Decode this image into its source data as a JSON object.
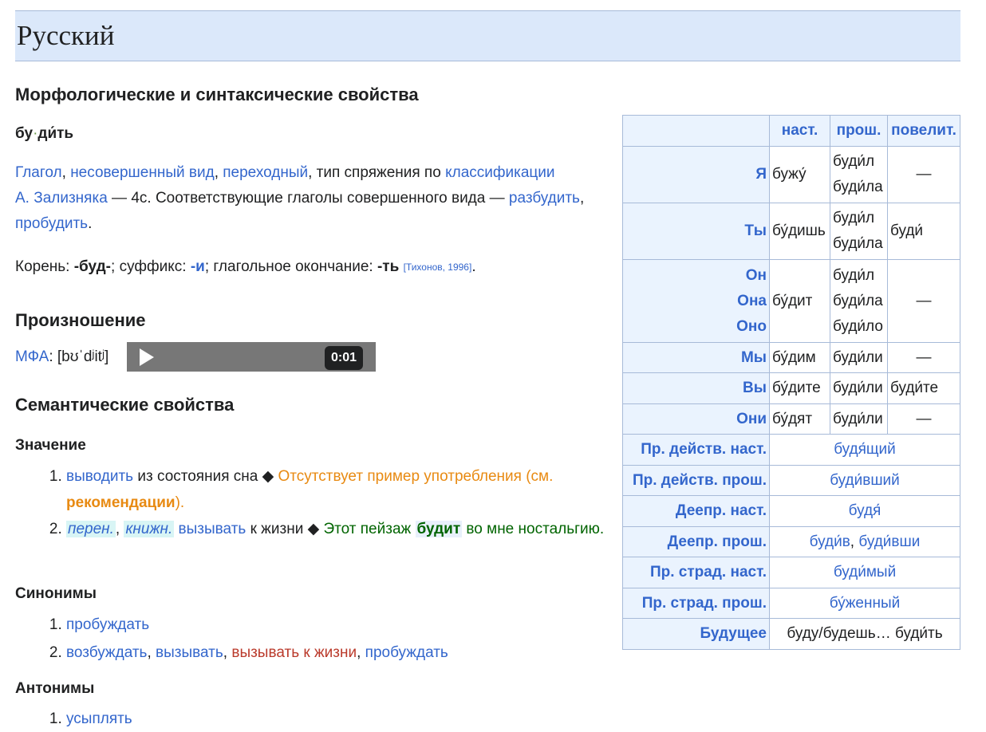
{
  "lang_header": "Русский",
  "morph": {
    "heading": "Морфологические и синтаксические свойства",
    "headword_part1": "бу",
    "headword_sep": "·",
    "headword_part2": "ди́ть",
    "desc": {
      "verb": "Глагол",
      "aspect": "несовершенный вид",
      "transitive": "переходный",
      "text1": ", тип спряжения по ",
      "classification_link": "классификации",
      "zaliznyak_link": "А. Зализняка",
      "text2": " — 4c. Соответствующие глаголы совершенного вида — ",
      "perf1": "разбудить",
      "perf2": "пробудить",
      "period": "."
    },
    "root_label": "Корень: ",
    "root": "-буд-",
    "suffix_label": "; суффикс: ",
    "suffix": "-и",
    "ending_label": "; глагольное окончание: ",
    "ending": "-ть",
    "ref": "[Тихонов, 1996]",
    "end": "."
  },
  "pron": {
    "heading": "Произношение",
    "ipa_label": "МФА",
    "ipa": ": [bʊˈdʲitʲ]",
    "audio_time": "0:01"
  },
  "semantic": {
    "heading": "Семантические свойства",
    "meaning_heading": "Значение",
    "m1_link": "выводить",
    "m1_text": " из состояния сна ◆ ",
    "m1_missing": "Отсутствует пример употребления (см. ",
    "m1_rec": "рекомендации",
    "m1_close": ").",
    "m2_label1": "перен.",
    "m2_label2": "книжн.",
    "m2_link": "вызывать",
    "m2_text": " к жизни ◆ ",
    "m2_ex1": "Этот пейзаж ",
    "m2_ex_word": "будит",
    "m2_ex2": " во мне ностальгию.",
    "syn_heading": "Синонимы",
    "syn1": "пробуждать",
    "syn2a": "возбуждать",
    "syn2b": "вызывать",
    "syn2c": "вызывать к жизни",
    "syn2d": "пробуждать",
    "ant_heading": "Антонимы",
    "ant1": "усыплять"
  },
  "conj": {
    "h_pres": "наст.",
    "h_past": "прош.",
    "h_imp": "повелит.",
    "ya": "Я",
    "ya_pres": "бужу́",
    "ya_past1": "буди́л",
    "ya_past2": "буди́ла",
    "ya_imp": "—",
    "ty": "Ты",
    "ty_pres": "бу́дишь",
    "ty_past1": "буди́л",
    "ty_past2": "буди́ла",
    "ty_imp": "буди́",
    "on": "Он",
    "ona": "Она",
    "ono": "Оно",
    "on_pres": "бу́дит",
    "on_past1": "буди́л",
    "on_past2": "буди́ла",
    "on_past3": "буди́ло",
    "on_imp": "—",
    "my": "Мы",
    "my_pres": "бу́дим",
    "my_past": "буди́ли",
    "my_imp": "—",
    "vy": "Вы",
    "vy_pres": "бу́дите",
    "vy_past": "буди́ли",
    "vy_imp": "буди́те",
    "oni": "Они",
    "oni_pres": "бу́дят",
    "oni_past": "буди́ли",
    "oni_imp": "—",
    "pa_pres_lbl": "Пр. действ. наст.",
    "pa_pres": "будя́щий",
    "pa_past_lbl": "Пр. действ. прош.",
    "pa_past": "буди́вший",
    "ger_pres_lbl": "Деепр. наст.",
    "ger_pres": "будя́",
    "ger_past_lbl": "Деепр. прош.",
    "ger_past1": "буди́в",
    "ger_past_sep": ", ",
    "ger_past2": "буди́вши",
    "pp_pres_lbl": "Пр. страд. наст.",
    "pp_pres": "буди́мый",
    "pp_past_lbl": "Пр. страд. прош.",
    "pp_past": "бу́женный",
    "fut_lbl": "Будущее",
    "fut": "буду/будешь… буди́ть"
  }
}
